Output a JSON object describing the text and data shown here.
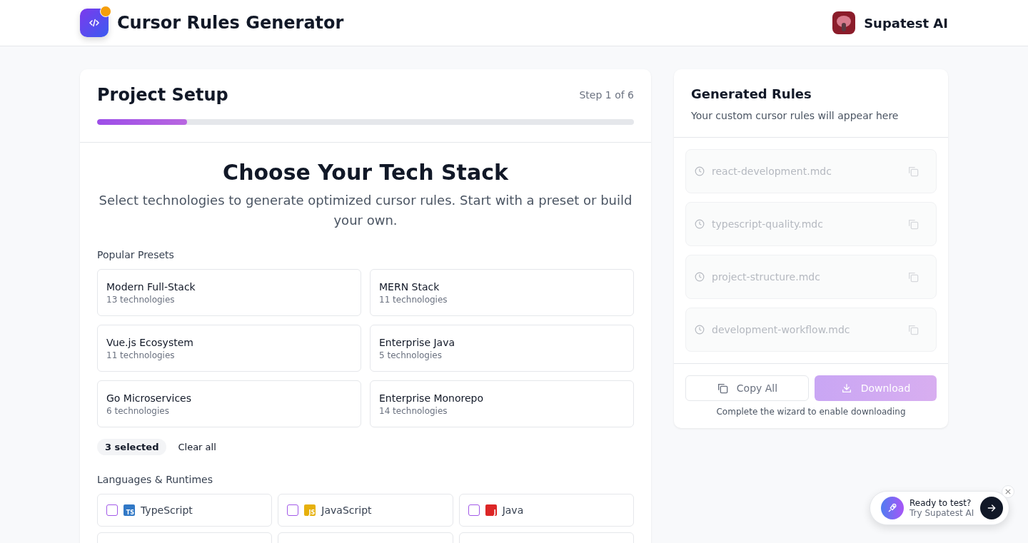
{
  "header": {
    "title": "Cursor Rules Generator",
    "brand": "Supatest AI"
  },
  "setup": {
    "title": "Project Setup",
    "step": "Step 1 of 6",
    "level": 0.167
  },
  "stack": {
    "heading": "Choose Your Tech Stack",
    "description": "Select technologies to generate optimized cursor rules. Start with a preset or build your own.",
    "presets_label": "Popular Presets",
    "presets": [
      {
        "name": "Modern Full-Stack",
        "count": "13 technologies"
      },
      {
        "name": "MERN Stack",
        "count": "11 technologies"
      },
      {
        "name": "Vue.js Ecosystem",
        "count": "11 technologies"
      },
      {
        "name": "Enterprise Java",
        "count": "5 technologies"
      },
      {
        "name": "Go Microservices",
        "count": "6 technologies"
      },
      {
        "name": "Enterprise Monorepo",
        "count": "14 technologies"
      }
    ],
    "selected_count": "3 selected",
    "clear": "Clear all",
    "languages_label": "Languages & Runtimes",
    "languages": [
      {
        "name": "TypeScript",
        "badge": "TS",
        "color": "#3178c6",
        "checked": false
      },
      {
        "name": "JavaScript",
        "badge": "JS",
        "color": "#e6b00c",
        "checked": false
      },
      {
        "name": "Java",
        "badge": "J",
        "color": "#dc2626",
        "checked": false
      }
    ]
  },
  "rules": {
    "title": "Generated Rules",
    "subtitle": "Your custom cursor rules will appear here",
    "files": [
      {
        "name": "react-development.mdc",
        "disabled": true
      },
      {
        "name": "typescript-quality.mdc",
        "disabled": true
      },
      {
        "name": "project-structure.mdc",
        "disabled": true
      },
      {
        "name": "development-workflow.mdc",
        "disabled": true
      }
    ],
    "copy_all": "Copy All",
    "download": "Download",
    "download_disabled": true,
    "hint": "Complete the wizard to enable downloading"
  },
  "promo": {
    "title": "Ready to test?",
    "subtitle": "Try Supatest AI"
  }
}
